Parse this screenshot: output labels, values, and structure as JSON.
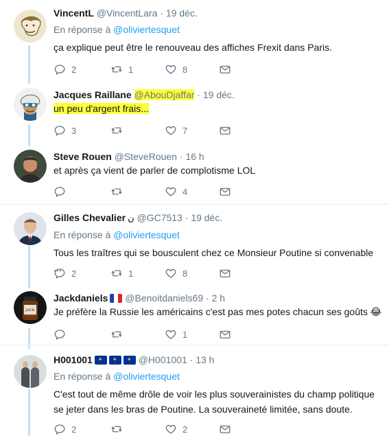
{
  "colors": {
    "accent": "#1da1f2",
    "thread_line": "#c3dff3",
    "highlight": "#ffff3a",
    "muted": "#657786"
  },
  "tweets": [
    {
      "name": "VincentL",
      "handle": "@VincentLara",
      "sep": "·",
      "time": "19 déc.",
      "reply_prefix": "En réponse à",
      "reply_user": "@oliviertesquet",
      "text": "ça explique peut être le renouveau des affiches Frexit dans Paris.",
      "replies": "2",
      "retweets": "1",
      "likes": "8"
    },
    {
      "name": "Jacques Raillane",
      "handle": "@AbouDjaffar",
      "sep": "·",
      "time": "19 déc.",
      "text": "un peu d'argent frais...",
      "replies": "3",
      "retweets": "",
      "likes": "7"
    },
    {
      "name": "Steve Rouen",
      "handle": "@SteveRouen",
      "sep": "·",
      "time": "16 h",
      "text": "et après ça vient de parler de complotisme LOL",
      "replies": "",
      "retweets": "",
      "likes": "4"
    },
    {
      "name": "Gilles Chevalier",
      "name_extra": "ن",
      "handle": "@GC7513",
      "sep": "·",
      "time": "19 déc.",
      "reply_prefix": "En réponse à",
      "reply_user": "@oliviertesquet",
      "text": "Tous les traîtres qui se bousculent chez ce Monsieur Poutine si convenable ...",
      "replies": "2",
      "retweets": "1",
      "likes": "8"
    },
    {
      "name": "Jackdaniels",
      "handle": "@Benoitdaniels69",
      "sep": "·",
      "time": "2 h",
      "text": "Je préfère la Russie les américains c'est pas mes potes chacun ses goûts 😂",
      "replies": "",
      "retweets": "",
      "likes": "1"
    },
    {
      "name": "H001001",
      "handle": "@H001001",
      "sep": "·",
      "time": "13 h",
      "reply_prefix": "En réponse à",
      "reply_user": "@oliviertesquet",
      "text": "C'est tout de même drôle de voir les plus souverainistes du champ politique se jeter dans les bras de Poutine. La souveraineté limitée, sans doute.",
      "replies": "2",
      "retweets": "",
      "likes": "2"
    }
  ]
}
